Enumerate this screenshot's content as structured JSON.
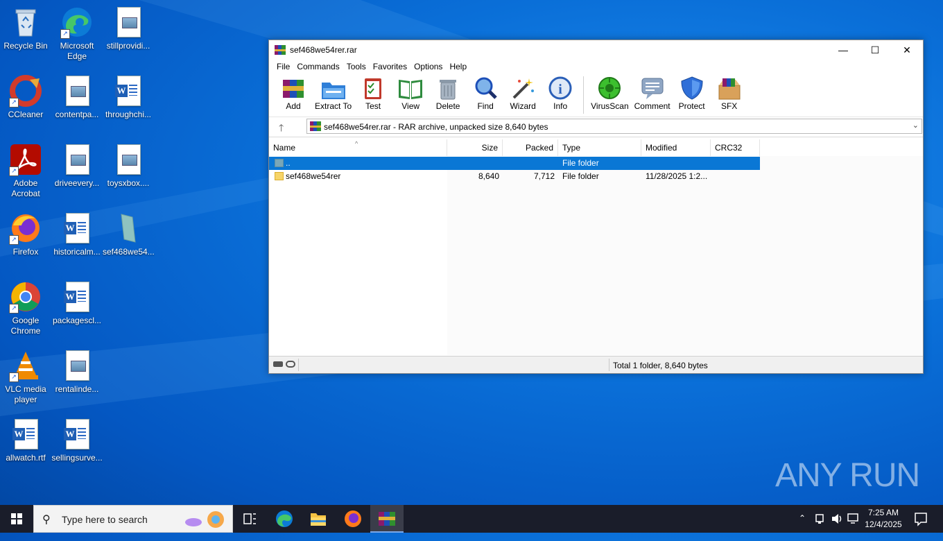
{
  "desktop": {
    "icons": [
      {
        "label": "Recycle Bin",
        "icon": "recycle-bin-icon"
      },
      {
        "label": "Microsoft Edge",
        "icon": "edge-icon"
      },
      {
        "label": "stillprovidi...",
        "icon": "image-file-icon"
      },
      {
        "label": "CCleaner",
        "icon": "ccleaner-icon"
      },
      {
        "label": "contentpa...",
        "icon": "image-file-icon"
      },
      {
        "label": "throughchi...",
        "icon": "word-file-icon"
      },
      {
        "label": "Adobe Acrobat",
        "icon": "acrobat-icon"
      },
      {
        "label": "driveevery...",
        "icon": "image-file-icon"
      },
      {
        "label": "toysxbox....",
        "icon": "image-file-icon"
      },
      {
        "label": "Firefox",
        "icon": "firefox-icon"
      },
      {
        "label": "historicalm...",
        "icon": "word-file-icon"
      },
      {
        "label": "sef468we54...",
        "icon": "folder-file-icon"
      },
      {
        "label": "Google Chrome",
        "icon": "chrome-icon"
      },
      {
        "label": "packagescl...",
        "icon": "word-file-icon"
      },
      {
        "label": "VLC media player",
        "icon": "vlc-icon"
      },
      {
        "label": "rentalinde...",
        "icon": "image-file-icon"
      },
      {
        "label": "allwatch.rtf",
        "icon": "word-file-icon"
      },
      {
        "label": "sellingsurve...",
        "icon": "word-file-icon"
      }
    ]
  },
  "window": {
    "title": "sef468we54rer.rar",
    "controls": {
      "minimize": "—",
      "maximize": "☐",
      "close": "✕"
    },
    "menu": [
      "File",
      "Commands",
      "Tools",
      "Favorites",
      "Options",
      "Help"
    ],
    "toolbar": [
      {
        "label": "Add",
        "icon": "add-archive-icon"
      },
      {
        "label": "Extract To",
        "icon": "extract-folder-icon"
      },
      {
        "label": "Test",
        "icon": "test-clipboard-icon"
      },
      {
        "label": "View",
        "icon": "view-book-icon"
      },
      {
        "label": "Delete",
        "icon": "trash-icon"
      },
      {
        "label": "Find",
        "icon": "magnifier-icon"
      },
      {
        "label": "Wizard",
        "icon": "wizard-wand-icon"
      },
      {
        "label": "Info",
        "icon": "info-icon"
      },
      {
        "label": "VirusScan",
        "icon": "virus-scan-icon"
      },
      {
        "label": "Comment",
        "icon": "comment-icon"
      },
      {
        "label": "Protect",
        "icon": "shield-icon"
      },
      {
        "label": "SFX",
        "icon": "sfx-box-icon"
      }
    ],
    "address": "sef468we54rer.rar - RAR archive, unpacked size 8,640 bytes",
    "columns": {
      "name": "Name",
      "size": "Size",
      "packed": "Packed",
      "type": "Type",
      "modified": "Modified",
      "crc": "CRC32"
    },
    "rows": [
      {
        "name": "..",
        "size": "",
        "packed": "",
        "type": "File folder",
        "modified": "",
        "crc": ""
      },
      {
        "name": "sef468we54rer",
        "size": "8,640",
        "packed": "7,712",
        "type": "File folder",
        "modified": "11/28/2025 1:2...",
        "crc": ""
      }
    ],
    "status": "Total 1 folder, 8,640 bytes"
  },
  "watermark": "ANY RUN",
  "taskbar": {
    "search_placeholder": "Type here to search",
    "time": "7:25 AM",
    "date": "12/4/2025"
  }
}
